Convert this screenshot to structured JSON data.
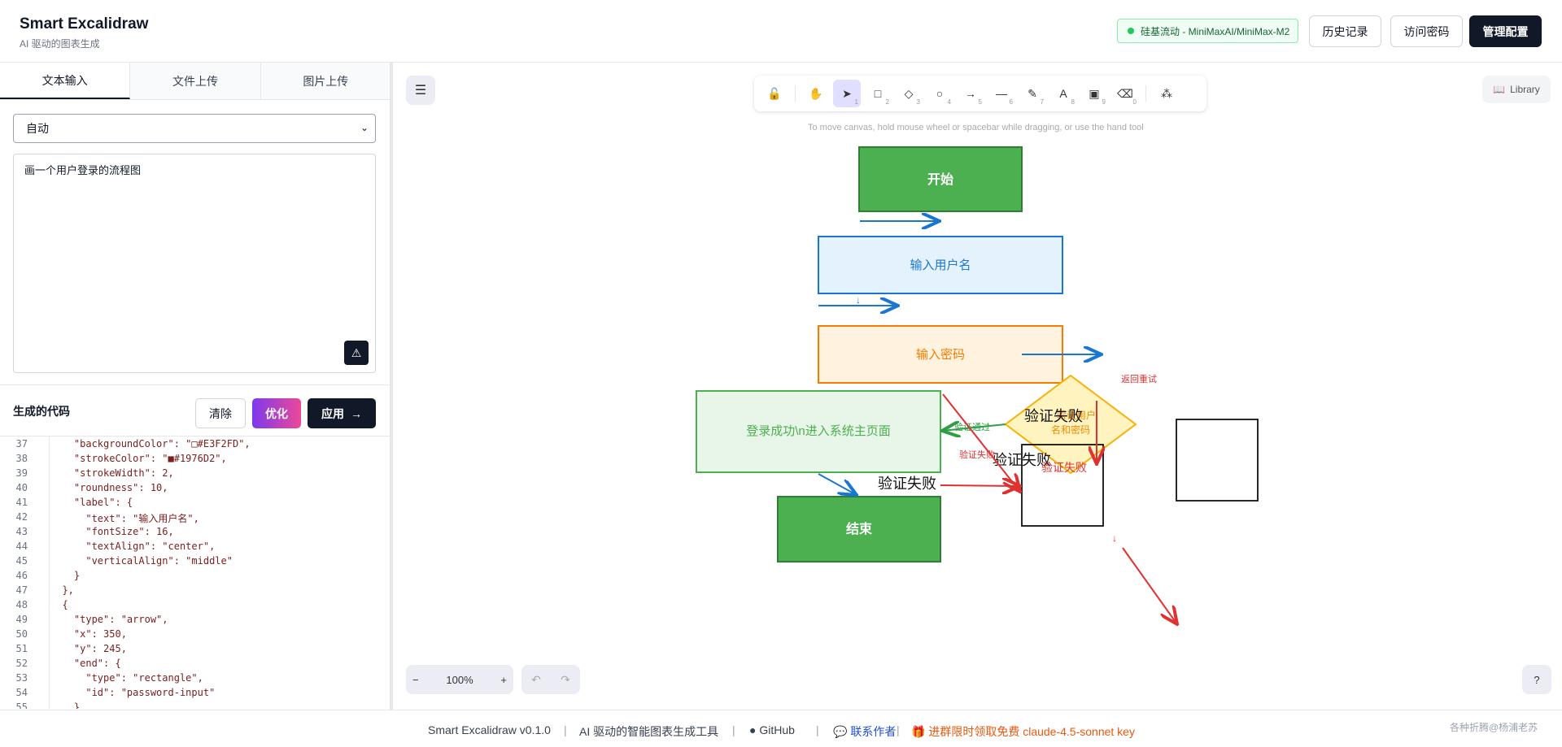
{
  "header": {
    "title": "Smart Excalidraw",
    "subtitle": "AI 驱动的图表生成",
    "model_badge": "硅基流动 - MiniMaxAI/MiniMax-M2",
    "history_label": "历史记录",
    "access_label": "访问密码",
    "admin_label": "管理配置",
    "colors": {
      "accent_dark": "#111827",
      "badge_green": "#22c55e"
    }
  },
  "left_panel": {
    "tabs": [
      {
        "label": "文本输入",
        "active": true
      },
      {
        "label": "文件上传",
        "active": false
      },
      {
        "label": "图片上传",
        "active": false
      }
    ],
    "mode_select": {
      "selected": "自动"
    },
    "prompt_text": "画一个用户登录的流程图",
    "code_section": {
      "title": "生成的代码",
      "clear_label": "清除",
      "optimize_label": "优化",
      "apply_label": "应用"
    },
    "code_lines": [
      {
        "n": "37",
        "text": "    \"backgroundColor\": \"□#E3F2FD\","
      },
      {
        "n": "38",
        "text": "    \"strokeColor\": \"■#1976D2\","
      },
      {
        "n": "39",
        "text": "    \"strokeWidth\": 2,"
      },
      {
        "n": "40",
        "text": "    \"roundness\": 10,"
      },
      {
        "n": "41",
        "text": "    \"label\": {"
      },
      {
        "n": "42",
        "text": "      \"text\": \"输入用户名\","
      },
      {
        "n": "43",
        "text": "      \"fontSize\": 16,"
      },
      {
        "n": "44",
        "text": "      \"textAlign\": \"center\","
      },
      {
        "n": "45",
        "text": "      \"verticalAlign\": \"middle\""
      },
      {
        "n": "46",
        "text": "    }"
      },
      {
        "n": "47",
        "text": "  },"
      },
      {
        "n": "48",
        "text": "  {"
      },
      {
        "n": "49",
        "text": "    \"type\": \"arrow\","
      },
      {
        "n": "50",
        "text": "    \"x\": 350,"
      },
      {
        "n": "51",
        "text": "    \"y\": 245,"
      },
      {
        "n": "52",
        "text": "    \"end\": {"
      },
      {
        "n": "53",
        "text": "      \"type\": \"rectangle\","
      },
      {
        "n": "54",
        "text": "      \"id\": \"password-input\""
      },
      {
        "n": "55",
        "text": "    }"
      }
    ]
  },
  "canvas": {
    "toolbar": {
      "tools": [
        {
          "icon": "lock-icon",
          "glyph": "🔓",
          "key": ""
        },
        {
          "icon": "hand-icon",
          "glyph": "✋",
          "key": ""
        },
        {
          "icon": "select-icon",
          "glyph": "➤",
          "key": "1",
          "selected": true
        },
        {
          "icon": "rectangle-icon",
          "glyph": "□",
          "key": "2"
        },
        {
          "icon": "diamond-icon",
          "glyph": "◇",
          "key": "3"
        },
        {
          "icon": "ellipse-icon",
          "glyph": "○",
          "key": "4"
        },
        {
          "icon": "arrow-icon",
          "glyph": "→",
          "key": "5"
        },
        {
          "icon": "line-icon",
          "glyph": "—",
          "key": "6"
        },
        {
          "icon": "pencil-icon",
          "glyph": "✎",
          "key": "7"
        },
        {
          "icon": "text-icon",
          "glyph": "A",
          "key": "8"
        },
        {
          "icon": "image-icon",
          "glyph": "▣",
          "key": "9"
        },
        {
          "icon": "eraser-icon",
          "glyph": "⌫",
          "key": "0"
        },
        {
          "icon": "shapes-icon",
          "glyph": "⁂",
          "key": ""
        }
      ]
    },
    "hint": "To move canvas, hold mouse wheel or spacebar while dragging, or use the hand tool",
    "library_label": "Library",
    "zoom_label": "100%",
    "diagram": {
      "start": "开始",
      "username": "输入用户名",
      "password": "输入密码",
      "success": "登录成功\\n进入系统主页面",
      "end": "结束",
      "diamond_text": "验证用户名和密码",
      "fail_big_1": "验证失败",
      "fail_big_2": "验证失败",
      "fail_big_3": "验证失败",
      "fail_small": "验证失败",
      "fail_red": "验证失败",
      "pass": "验证通过",
      "retry": "返回重试",
      "down_arrow": "↓"
    }
  },
  "footer": {
    "version": "Smart Excalidraw v0.1.0",
    "sep": "|",
    "tagline": "AI 驱动的智能图表生成工具",
    "github": "GitHub",
    "contact": "联系作者",
    "promo": "进群限时领取免费 claude-4.5-sonnet key",
    "watermark": "各种折腾@杨浦老苏"
  }
}
